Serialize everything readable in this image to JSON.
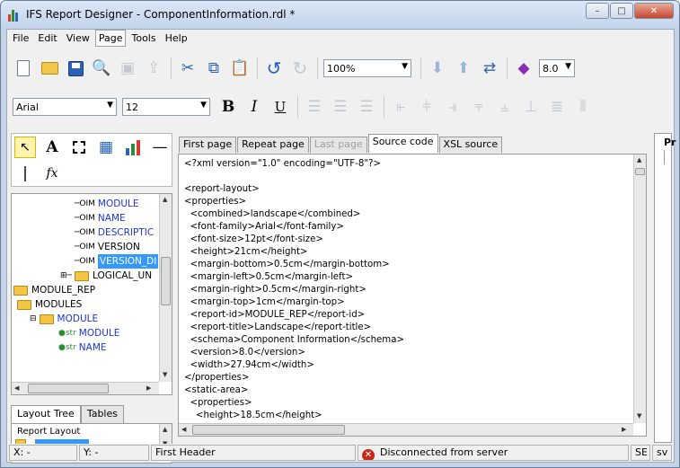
{
  "window": {
    "title": "IFS Report Designer - ComponentInformation.rdl *",
    "minimize": "–",
    "maximize": "□",
    "close": "✕"
  },
  "menu": [
    "File",
    "Edit",
    "View",
    "Page",
    "Tools",
    "Help"
  ],
  "menu_active": "Page",
  "toolbar1": {
    "zoom": "100%",
    "version": "8.0",
    "icons": [
      "new-file-icon",
      "open-folder-icon",
      "save-icon",
      "print-preview-icon",
      "cut-icon",
      "copy-icon",
      "paste-icon",
      "undo-icon",
      "redo-icon",
      "move-down-icon",
      "move-up-icon",
      "swap-icon",
      "publish-icon"
    ]
  },
  "toolbar2": {
    "font": "Arial",
    "size": "12",
    "bold": "B",
    "italic": "I",
    "underline": "U"
  },
  "palette": {
    "text_tool": "A",
    "function_tool": "fx"
  },
  "tree": {
    "rows": [
      {
        "icon": "OIM",
        "label": "MODULE",
        "style": "field"
      },
      {
        "icon": "OIM",
        "label": "NAME",
        "style": "field"
      },
      {
        "icon": "OIM",
        "label": "DESCRIPTIC",
        "style": "field"
      },
      {
        "icon": "OIM",
        "label": "VERSION",
        "style": "plain"
      },
      {
        "icon": "OIM",
        "label": "VERSION_DI",
        "style": "selected"
      },
      {
        "icon": "folder",
        "label": "LOGICAL_UN",
        "style": "plain"
      },
      {
        "icon": "folder",
        "label": "MODULE_REP",
        "style": "plain"
      },
      {
        "icon": "folder",
        "label": "MODULES",
        "style": "plain"
      },
      {
        "icon": "folder",
        "label": "MODULE",
        "style": "field"
      },
      {
        "icon": "str",
        "label": "MODULE",
        "style": "field"
      },
      {
        "icon": "str",
        "label": "NAME",
        "style": "field"
      }
    ]
  },
  "left_tabs": [
    "Layout Tree",
    "Tables"
  ],
  "layout_box": {
    "title": "Report Layout"
  },
  "editor": {
    "tabs": [
      "First page",
      "Repeat page",
      "Last page",
      "Source code",
      "XSL source"
    ],
    "active_tab": "Source code",
    "disabled_tab": "Last page",
    "lines": [
      "<?xml version=\"1.0\" encoding=\"UTF-8\"?>",
      "",
      "<report-layout>",
      "<properties>",
      "  <combined>landscape</combined>",
      "  <font-family>Arial</font-family>",
      "  <font-size>12pt</font-size>",
      "  <height>21cm</height>",
      "  <margin-bottom>0.5cm</margin-bottom>",
      "  <margin-left>0.5cm</margin-left>",
      "  <margin-right>0.5cm</margin-right>",
      "  <margin-top>1cm</margin-top>",
      "  <report-id>MODULE_REP</report-id>",
      "  <report-title>Landscape</report-title>",
      "  <schema>Component Information</schema>",
      "  <version>8.0</version>",
      "  <width>27.94cm</width>",
      "</properties>",
      "<static-area>",
      "  <properties>",
      "    <height>18.5cm</height>"
    ]
  },
  "right_pane": {
    "label": "Pr"
  },
  "status": {
    "x": "X: -",
    "y": "Y: -",
    "section": "First Header",
    "connection": "Disconnected from server",
    "se": "SE",
    "sv": "sv"
  }
}
